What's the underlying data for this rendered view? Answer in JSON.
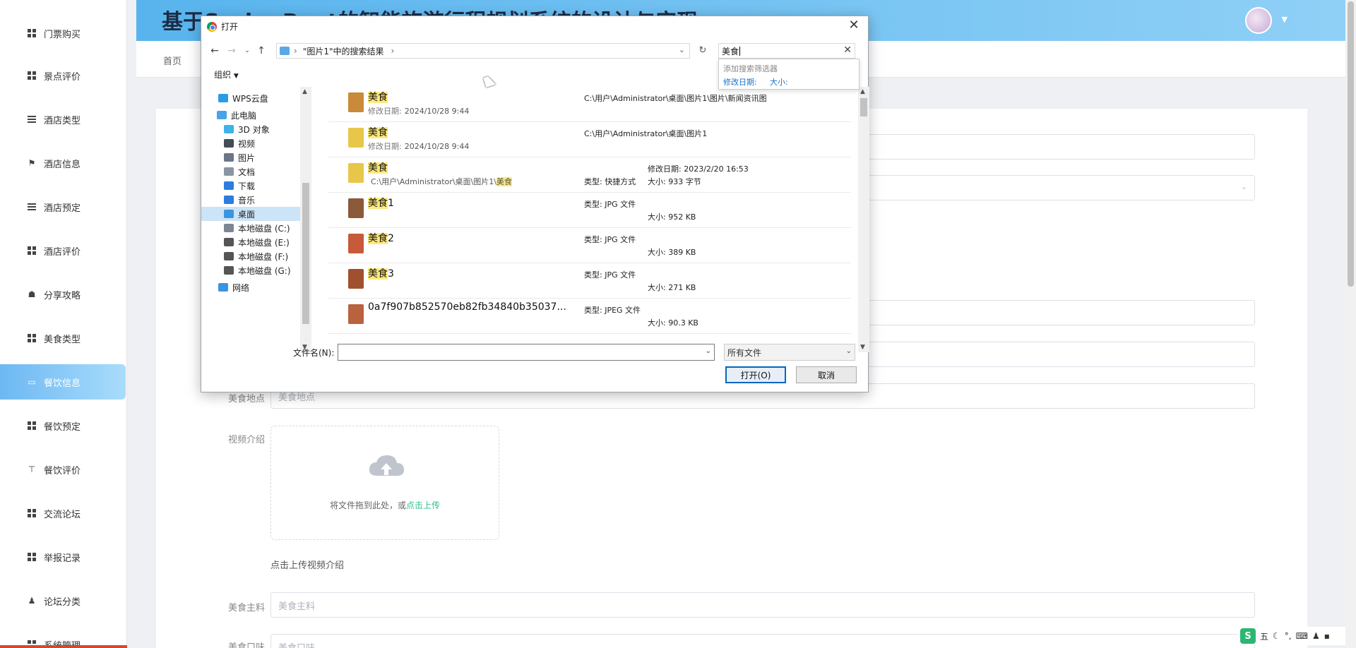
{
  "sidebar": {
    "items": [
      {
        "label": "门票购买",
        "icon": "grid-icon"
      },
      {
        "label": "景点评价",
        "icon": "grid-icon"
      },
      {
        "label": "酒店类型",
        "icon": "list-icon"
      },
      {
        "label": "酒店信息",
        "icon": "flag-icon"
      },
      {
        "label": "酒店预定",
        "icon": "list-icon"
      },
      {
        "label": "酒店评价",
        "icon": "grid-icon"
      },
      {
        "label": "分享攻略",
        "icon": "share-icon"
      },
      {
        "label": "美食类型",
        "icon": "grid-icon"
      },
      {
        "label": "餐饮信息",
        "icon": "monitor-icon"
      },
      {
        "label": "餐饮预定",
        "icon": "grid-icon"
      },
      {
        "label": "餐饮评价",
        "icon": "pin-icon"
      },
      {
        "label": "交流论坛",
        "icon": "grid-icon"
      },
      {
        "label": "举报记录",
        "icon": "grid-icon"
      },
      {
        "label": "论坛分类",
        "icon": "user-icon"
      },
      {
        "label": "系统管理",
        "icon": "grid-icon"
      }
    ]
  },
  "header": {
    "title": "基于SpringBoot的智能旅游行程规划系统的设计与实现"
  },
  "tabs": {
    "home": "首页"
  },
  "form": {
    "food_location_label": "美食地点",
    "food_location_placeholder": "美食地点",
    "video_intro_label": "视频介绍",
    "upload_text": "将文件拖到此处，或",
    "upload_link": "点击上传",
    "upload_tip": "点击上传视频介绍",
    "main_ingredient_label": "美食主料",
    "main_ingredient_placeholder": "美食主料",
    "food_taste_label": "美食口味",
    "food_taste_placeholder": "美食口味"
  },
  "dialog": {
    "title": "打开",
    "breadcrumb": "\"图片1\"中的搜索结果",
    "search_value": "美食",
    "search_popup": {
      "title": "添加搜索筛选器",
      "modified_date": "修改日期:",
      "size": "大小:"
    },
    "organize": "组织",
    "nav_items": [
      {
        "label": "WPS云盘",
        "color": "#2b9be8"
      },
      {
        "label": "此电脑",
        "color": "#4aa3e6"
      },
      {
        "label": "3D 对象",
        "color": "#3fb2e8"
      },
      {
        "label": "视频",
        "color": "#444c58"
      },
      {
        "label": "图片",
        "color": "#6b7686"
      },
      {
        "label": "文档",
        "color": "#8a95a3"
      },
      {
        "label": "下载",
        "color": "#2b7de0"
      },
      {
        "label": "音乐",
        "color": "#2b7de0"
      },
      {
        "label": "桌面",
        "color": "#3a95e0"
      },
      {
        "label": "本地磁盘 (C:)",
        "color": "#7b8794"
      },
      {
        "label": "本地磁盘 (E:)",
        "color": "#555"
      },
      {
        "label": "本地磁盘 (F:)",
        "color": "#555"
      },
      {
        "label": "本地磁盘 (G:)",
        "color": "#555"
      },
      {
        "label": "网络",
        "color": "#3a95e0"
      }
    ],
    "files": [
      {
        "name_hl": "美食",
        "name_rest": "",
        "sub_key": "修改日期:",
        "sub_val": "2024/10/28 9:44",
        "col2": "C:\\用户\\Administrator\\桌面\\图片1\\图片\\新闻资讯图",
        "col2b": "",
        "col3": "",
        "col3b": "",
        "thumb": "#c98a3a"
      },
      {
        "name_hl": "美食",
        "name_rest": "",
        "sub_key": "修改日期:",
        "sub_val": "2024/10/28 9:44",
        "col2": "C:\\用户\\Administrator\\桌面\\图片1",
        "col2b": "",
        "col3": "",
        "col3b": "",
        "thumb": "#e8c64a"
      },
      {
        "name_hl": "美食",
        "name_rest": "",
        "sub_key": "",
        "sub_val": "C:\\用户\\Administrator\\桌面\\图片1\\",
        "sub_hl": "美食",
        "col2": "",
        "col2b": "类型: 快捷方式",
        "col3": "修改日期: 2023/2/20 16:53",
        "col3b": "大小: 933 字节",
        "thumb": "#e8c64a"
      },
      {
        "name_hl": "美食",
        "name_rest": "1",
        "sub_key": "",
        "sub_val": "",
        "col2": "类型: JPG 文件",
        "col2b": "",
        "col3": "",
        "col3b": "大小: 952 KB",
        "thumb": "#8a5a3a"
      },
      {
        "name_hl": "美食",
        "name_rest": "2",
        "sub_key": "",
        "sub_val": "",
        "col2": "类型: JPG 文件",
        "col2b": "",
        "col3": "",
        "col3b": "大小: 389 KB",
        "thumb": "#c65a3a"
      },
      {
        "name_hl": "美食",
        "name_rest": "3",
        "sub_key": "",
        "sub_val": "",
        "col2": "类型: JPG 文件",
        "col2b": "",
        "col3": "",
        "col3b": "大小: 271 KB",
        "thumb": "#a0502e"
      },
      {
        "name_hl": "",
        "name_rest": "0a7f907b852570eb82fb34840b35037...",
        "sub_key": "",
        "sub_val": "",
        "col2": "类型: JPEG 文件",
        "col2b": "",
        "col3": "",
        "col3b": "大小: 90.3 KB",
        "thumb": "#b8623e"
      }
    ],
    "filename_label": "文件名(N):",
    "filename_value": "",
    "file_type": "所有文件",
    "open_button": "打开(O)",
    "cancel_button": "取消"
  },
  "tray": {
    "ime": "五"
  },
  "colors": {
    "header_gradient_start": "#58b4ee",
    "active_sidebar": "#6db8f3",
    "highlight": "#ffe97a",
    "link": "#2bbf93"
  }
}
